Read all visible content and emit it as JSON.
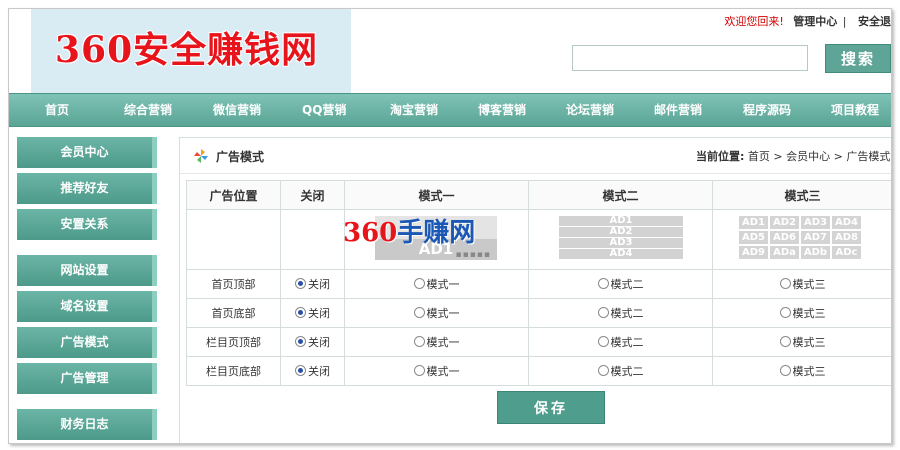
{
  "header": {
    "logo_text": "360安全赚钱网",
    "welcome": "欢迎您回来!",
    "admin_center": "管理中心",
    "separator": "|",
    "logout": "安全退",
    "search_value": "",
    "search_button": "搜索"
  },
  "nav": {
    "items": [
      "首页",
      "综合营销",
      "微信营销",
      "QQ营销",
      "淘宝营销",
      "博客营销",
      "论坛营销",
      "邮件营销",
      "程序源码",
      "项目教程"
    ]
  },
  "sidebar": {
    "items": [
      "会员中心",
      "推荐好友",
      "安置关系",
      "网站设置",
      "域名设置",
      "广告模式",
      "广告管理",
      "财务日志"
    ]
  },
  "content": {
    "title": "广告模式",
    "breadcrumb_label": "当前位置:",
    "breadcrumb": "首页 > 会员中心 > 广告模式",
    "icon": "pinwheel-icon"
  },
  "ad_table": {
    "headers": [
      "广告位置",
      "关闭",
      "模式一",
      "模式二",
      "模式三"
    ],
    "preview": {
      "mode1_text": "AD1",
      "mode1_dots": "▪▪▪▪▪",
      "watermark_a": "360",
      "watermark_b": "手赚网",
      "mode2_bars": [
        "AD1",
        "AD2",
        "AD3",
        "AD4"
      ],
      "mode3_cells": [
        "AD1",
        "AD2",
        "AD3",
        "AD4",
        "AD5",
        "AD6",
        "AD7",
        "AD8",
        "AD9",
        "ADa",
        "ADb",
        "ADc"
      ]
    },
    "rows": [
      {
        "position": "首页顶部",
        "close": "关闭",
        "mode1": "模式一",
        "mode2": "模式二",
        "mode3": "模式三"
      },
      {
        "position": "首页底部",
        "close": "关闭",
        "mode1": "模式一",
        "mode2": "模式二",
        "mode3": "模式三"
      },
      {
        "position": "栏目页顶部",
        "close": "关闭",
        "mode1": "模式一",
        "mode2": "模式二",
        "mode3": "模式三"
      },
      {
        "position": "栏目页底部",
        "close": "关闭",
        "mode1": "模式一",
        "mode2": "模式二",
        "mode3": "模式三"
      }
    ]
  },
  "save_button": "保存",
  "colors": {
    "accent": "#5fa597",
    "logo_red": "#e8141b",
    "welcome_red": "#d40000",
    "radio_selected": "#2a4fa3"
  }
}
